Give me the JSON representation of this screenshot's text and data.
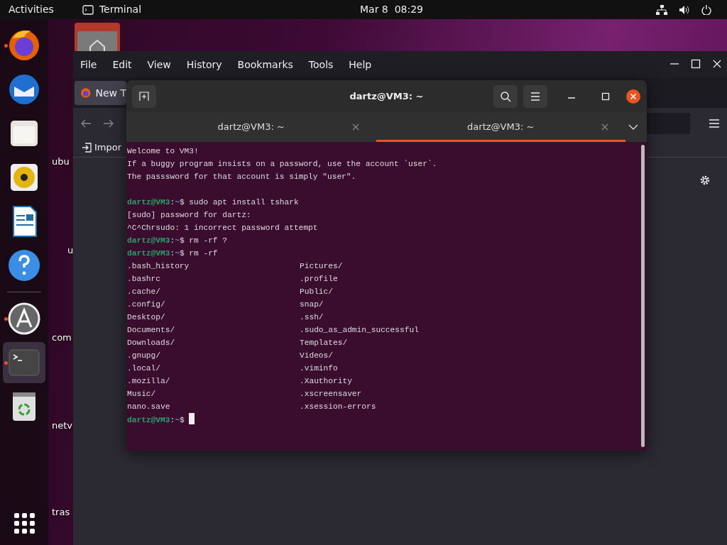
{
  "top_bar": {
    "activities": "Activities",
    "app_name": "Terminal",
    "clock": "Mar 8  08:29"
  },
  "dock": [
    {
      "running": true,
      "active": false
    },
    {
      "running": false,
      "active": false
    },
    {
      "running": false,
      "active": false
    },
    {
      "running": false,
      "active": false
    },
    {
      "running": false,
      "active": false
    },
    {
      "running": false,
      "active": false
    },
    {
      "running": true,
      "active": false
    },
    {
      "running": true,
      "active": true
    },
    {
      "running": false,
      "active": false
    }
  ],
  "desktop_labels": [
    "ubu",
    "u",
    "com",
    "netv",
    "tras"
  ],
  "browser": {
    "menu": [
      "File",
      "Edit",
      "View",
      "History",
      "Bookmarks",
      "Tools",
      "Help"
    ],
    "tab": "New T",
    "bookmark": "Impor"
  },
  "terminal": {
    "title": "dartz@VM3: ~",
    "tabs": [
      {
        "label": "dartz@VM3: ~",
        "selected": false
      },
      {
        "label": "dartz@VM3: ~",
        "selected": true
      }
    ],
    "lines": [
      {
        "kind": "text",
        "text": "Welcome to VM3!"
      },
      {
        "kind": "text",
        "text": "If a buggy program insists on a password, use the account `user`."
      },
      {
        "kind": "text",
        "text": "The passsword for that account is simply \"user\"."
      },
      {
        "kind": "blank"
      },
      {
        "kind": "prompt",
        "user": "dartz@VM3",
        "sep": ":",
        "path": "~",
        "sign": "$ ",
        "command": "sudo apt install tshark",
        "cursor": false
      },
      {
        "kind": "text",
        "text": "[sudo] password for dartz:"
      },
      {
        "kind": "text",
        "text": "^C^Chrsudo: 1 incorrect password attempt"
      },
      {
        "kind": "prompt",
        "user": "dartz@VM3",
        "sep": ":",
        "path": "~",
        "sign": "$ ",
        "command": "rm -rf ?",
        "cursor": false
      },
      {
        "kind": "prompt",
        "user": "dartz@VM3",
        "sep": ":",
        "path": "~",
        "sign": "$ ",
        "command": "rm -rf",
        "cursor": false
      },
      {
        "kind": "columns",
        "left": ".bash_history",
        "right": "Pictures/"
      },
      {
        "kind": "columns",
        "left": ".bashrc",
        "right": ".profile"
      },
      {
        "kind": "columns",
        "left": ".cache/",
        "right": "Public/"
      },
      {
        "kind": "columns",
        "left": ".config/",
        "right": "snap/"
      },
      {
        "kind": "columns",
        "left": "Desktop/",
        "right": ".ssh/"
      },
      {
        "kind": "columns",
        "left": "Documents/",
        "right": ".sudo_as_admin_successful"
      },
      {
        "kind": "columns",
        "left": "Downloads/",
        "right": "Templates/"
      },
      {
        "kind": "columns",
        "left": ".gnupg/",
        "right": "Videos/"
      },
      {
        "kind": "columns",
        "left": ".local/",
        "right": ".viminfo"
      },
      {
        "kind": "columns",
        "left": ".mozilla/",
        "right": ".Xauthority"
      },
      {
        "kind": "columns",
        "left": "Music/",
        "right": ".xscreensaver"
      },
      {
        "kind": "columns",
        "left": "nano.save",
        "right": ".xsession-errors"
      },
      {
        "kind": "prompt",
        "user": "dartz@VM3",
        "sep": ":",
        "path": "~",
        "sign": "$ ",
        "cursor": true
      }
    ]
  }
}
